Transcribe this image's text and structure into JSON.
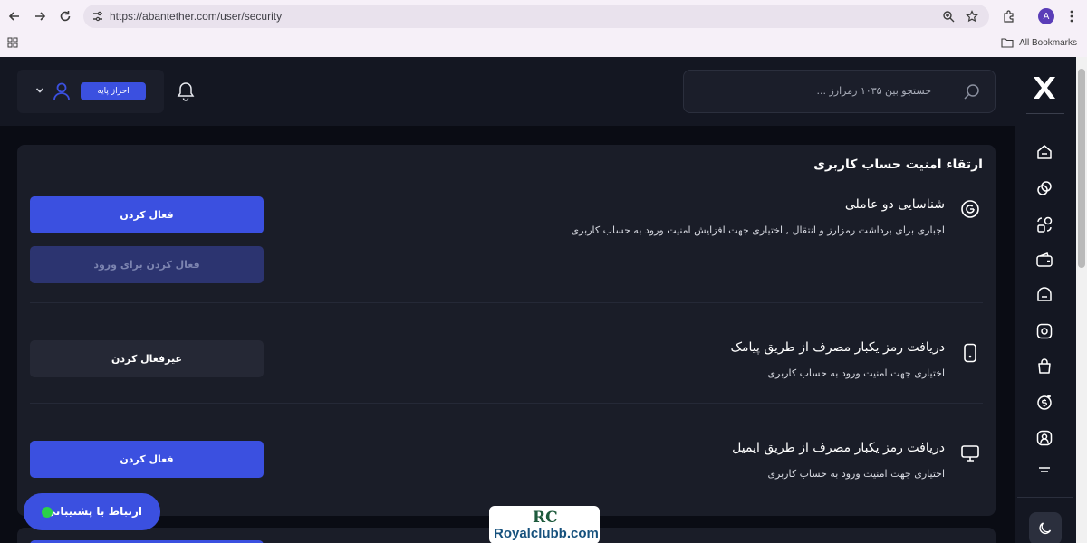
{
  "browser": {
    "url": "https://abantether.com/user/security",
    "profile_initial": "A",
    "bookmarks_label": "All Bookmarks"
  },
  "header": {
    "search_placeholder": "جستجو بین ۱۰۳۵ رمزارز ...",
    "verification_badge": "احراز پایه"
  },
  "security": {
    "title": "ارتقاء امنیت حساب کاربری",
    "sections": [
      {
        "title": "شناسایی دو عاملی",
        "description": "اجباری برای برداشت رمزارز و انتقال , اختیاری جهت افزایش امنیت ورود به حساب کاربری",
        "primary_button": "فعال کردن",
        "secondary_button": "فعال کردن برای ورود"
      },
      {
        "title": "دریافت رمز یکبار مصرف از طریق پیامک",
        "description": "اختیاری جهت امنیت ورود به حساب کاربری",
        "button": "غیرفعال کردن"
      },
      {
        "title": "دریافت رمز یکبار مصرف از طریق ایمیل",
        "description": "اختیاری جهت امنیت ورود به حساب کاربری",
        "button": "فعال کردن"
      }
    ]
  },
  "support": {
    "label": "ارتباط با پشتیبانی"
  },
  "watermark": {
    "mark": "RC",
    "text": "Royalclubb.com"
  },
  "colors": {
    "accent": "#3b50e0",
    "background": "#0a0c14",
    "card": "#1a1d28",
    "online": "#2bd14a"
  }
}
